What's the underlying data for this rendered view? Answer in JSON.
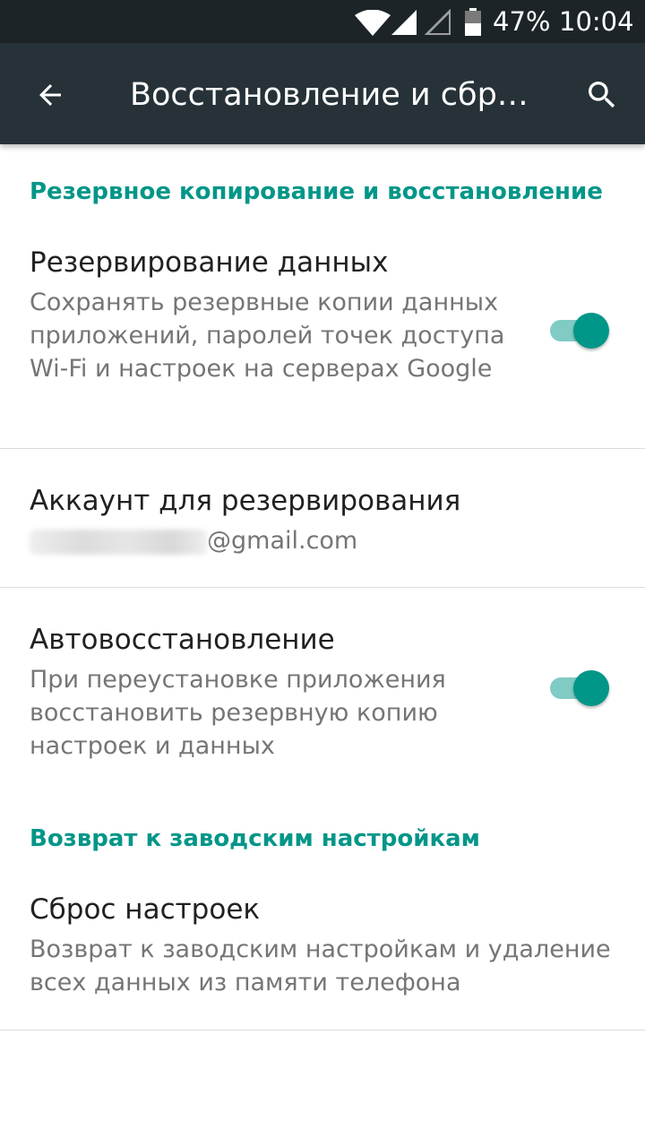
{
  "status_bar": {
    "battery_percent": "47%",
    "time": "10:04",
    "icons": [
      "wifi-icon",
      "signal-icon",
      "no-signal-icon",
      "battery-icon"
    ]
  },
  "toolbar": {
    "title": "Восстановление и сбр…",
    "back_icon": "arrow-back-icon",
    "search_icon": "search-icon"
  },
  "sections": {
    "backup": {
      "header": "Резервное копирование и восстановление",
      "backup_data": {
        "title": "Резервирование данных",
        "summary": "Сохранять резервные копии данных приложений, паролей точек доступа Wi-Fi и настроек на серверах Google",
        "enabled": true
      },
      "backup_account": {
        "title": "Аккаунт для резервирования",
        "email_suffix": "@gmail.com"
      },
      "auto_restore": {
        "title": "Автовосстановление",
        "summary": "При переустановке приложения восстановить резервную копию настроек и данных",
        "enabled": true
      }
    },
    "factory": {
      "header": "Возврат к заводским настройкам",
      "reset": {
        "title": "Сброс настроек",
        "summary": "Возврат к заводским настройкам и удаление всех данных из памяти телефона"
      }
    }
  },
  "colors": {
    "accent": "#009688",
    "toolbar": "#263238",
    "status_bar": "#1d2428",
    "switch_track": "#80cbc4"
  }
}
